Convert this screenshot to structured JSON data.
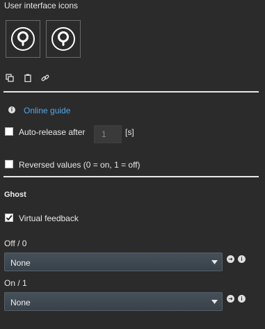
{
  "section_title": "User interface icons",
  "icons": {
    "preview_icon": "keyhole-icon",
    "tool_icons": [
      "copy-icon",
      "clipboard-icon",
      "link-icon"
    ]
  },
  "online_guide": {
    "icon": "info-icon",
    "label": "Online guide"
  },
  "auto_release": {
    "label": "Auto-release after",
    "checked": false,
    "value": "1",
    "unit": "[s]"
  },
  "reversed_values": {
    "label": "Reversed values (0 = on, 1 = off)",
    "checked": false
  },
  "ghost": {
    "heading": "Ghost",
    "virtual_feedback": {
      "label": "Virtual feedback",
      "checked": true
    }
  },
  "off_state": {
    "label": "Off / 0",
    "selected": "None"
  },
  "on_state": {
    "label": "On / 1",
    "selected": "None"
  },
  "colors": {
    "background": "#2b2b2b",
    "link": "#4fa8e8",
    "select_top": "#465059",
    "select_bottom": "#39424a"
  }
}
